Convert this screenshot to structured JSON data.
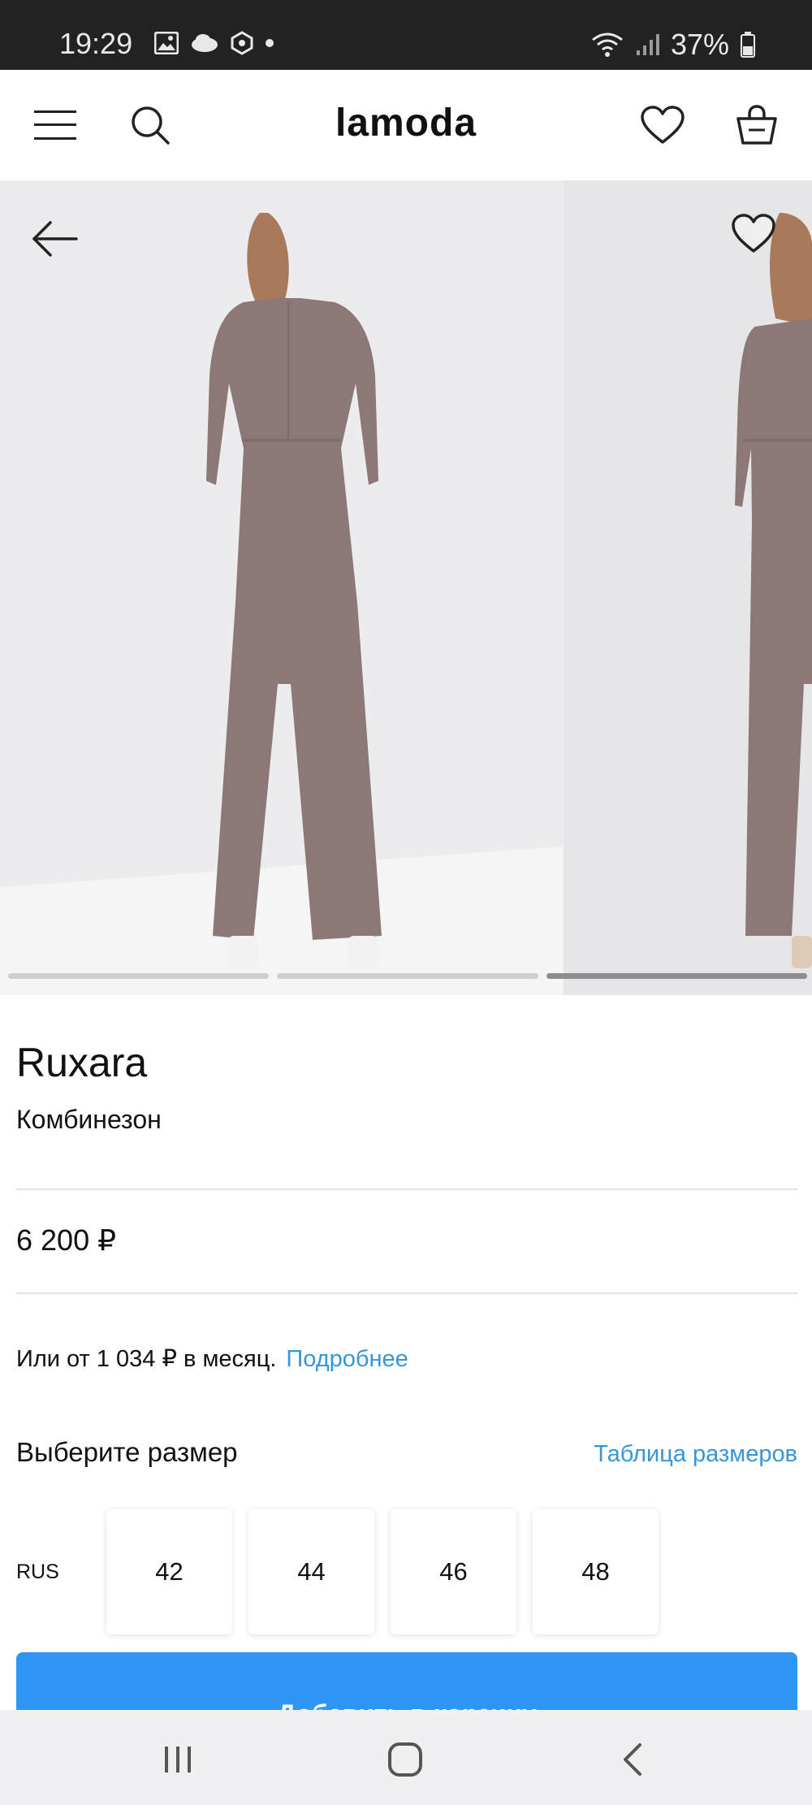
{
  "status_bar": {
    "time": "19:29",
    "battery": "37%",
    "icons": [
      "gallery-icon",
      "cloud-icon",
      "shield-icon",
      "dot-icon",
      "wifi-icon",
      "signal-icon",
      "battery-icon"
    ]
  },
  "header": {
    "logo": "lamoda",
    "icons": [
      "menu-icon",
      "search-icon",
      "heart-icon",
      "cart-icon"
    ]
  },
  "gallery": {
    "icons": [
      "arrow-left-icon",
      "heart-icon"
    ],
    "page_count": 3,
    "active_page": 3,
    "photo_description_color": "#8d7878"
  },
  "product": {
    "brand": "Ruxara",
    "type": "Комбинезон",
    "price": "6 200 ₽",
    "installment_text": "Или от 1 034 ₽ в месяц.",
    "installment_link": "Подробнее"
  },
  "sizes": {
    "title": "Выберите размер",
    "table_link": "Таблица размеров",
    "system": "RUS",
    "options": [
      "42",
      "44",
      "46",
      "48"
    ]
  },
  "cta": {
    "label": "Добавить в корзину"
  },
  "system_nav": {
    "icons": [
      "recent-apps-icon",
      "home-icon",
      "back-icon"
    ]
  },
  "colors": {
    "accent": "#2f97f3",
    "link": "#3596d8",
    "statusbar": "#222222"
  }
}
